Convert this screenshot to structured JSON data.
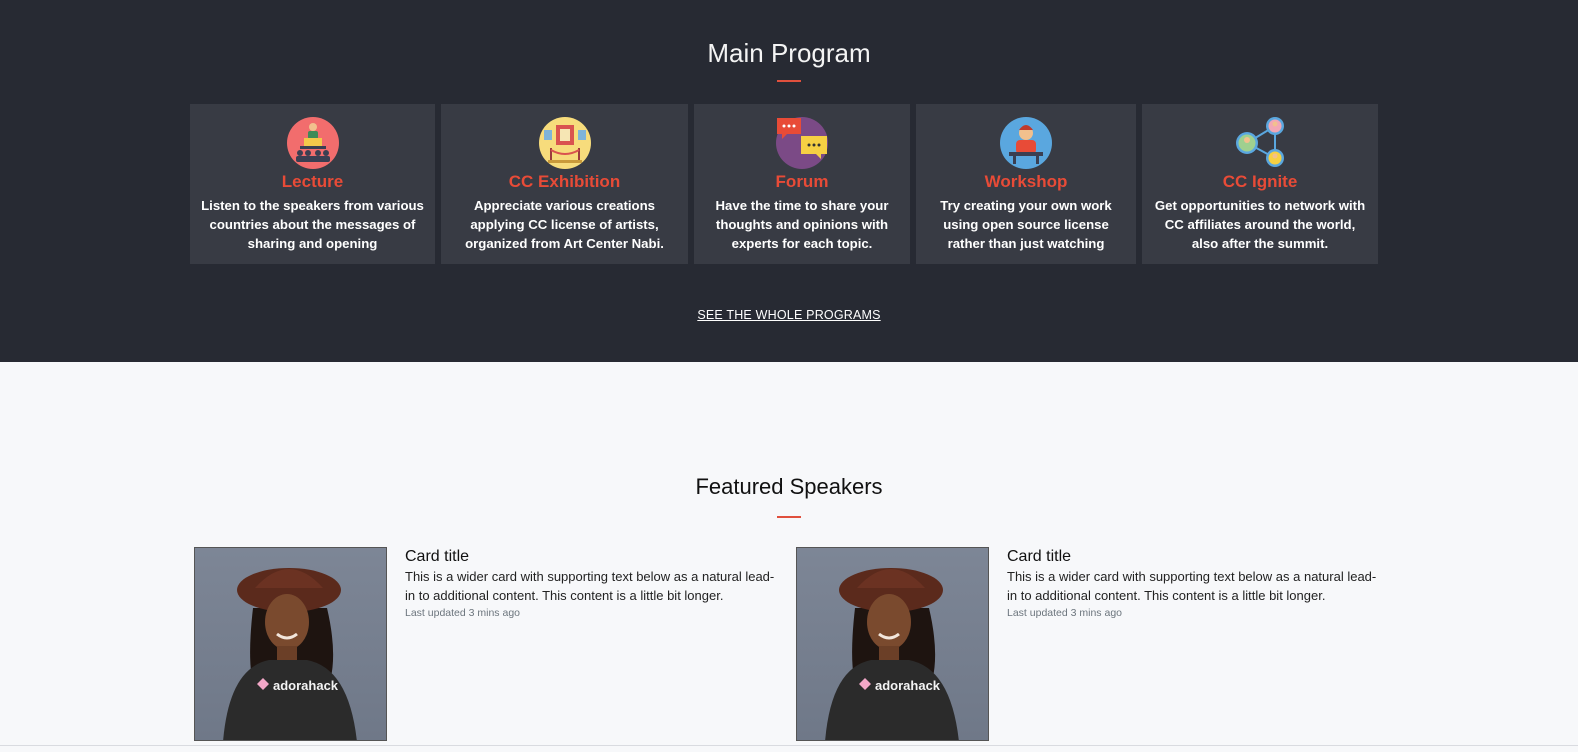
{
  "program": {
    "title": "Main Program",
    "cards": [
      {
        "name": "Lecture",
        "icon": "lecture-icon",
        "description": "Listen to the speakers from various countries about the messages of sharing and opening"
      },
      {
        "name": "CC Exhibition",
        "icon": "exhibition-icon",
        "description": "Appreciate various creations applying CC license of artists, organized from Art Center Nabi."
      },
      {
        "name": "Forum",
        "icon": "forum-chat-icon",
        "description": "Have the time to share your thoughts and opinions with experts for each topic."
      },
      {
        "name": "Workshop",
        "icon": "workshop-icon",
        "description": "Try creating your own work using open source license rather than just watching"
      },
      {
        "name": "CC Ignite",
        "icon": "network-icon",
        "description": "Get opportunities to network with CC affiliates around the world, also after the summit."
      }
    ],
    "see_all_label": "SEE THE WHOLE PROGRAMS"
  },
  "speakers": {
    "title": "Featured Speakers",
    "items": [
      {
        "title": "Card title",
        "text": "This is a wider card with supporting text below as a natural lead-in to additional content. This content is a little bit longer.",
        "meta": "Last updated 3 mins ago",
        "photo_text": "adorahack"
      },
      {
        "title": "Card title",
        "text": "This is a wider card with supporting text below as a natural lead-in to additional content. This content is a little bit longer.",
        "meta": "Last updated 3 mins ago",
        "photo_text": "adorahack"
      }
    ]
  },
  "colors": {
    "dark_bg": "#272a33",
    "card_bg": "#383b44",
    "accent": "#e84b37",
    "light_bg": "#f7f8fa"
  }
}
